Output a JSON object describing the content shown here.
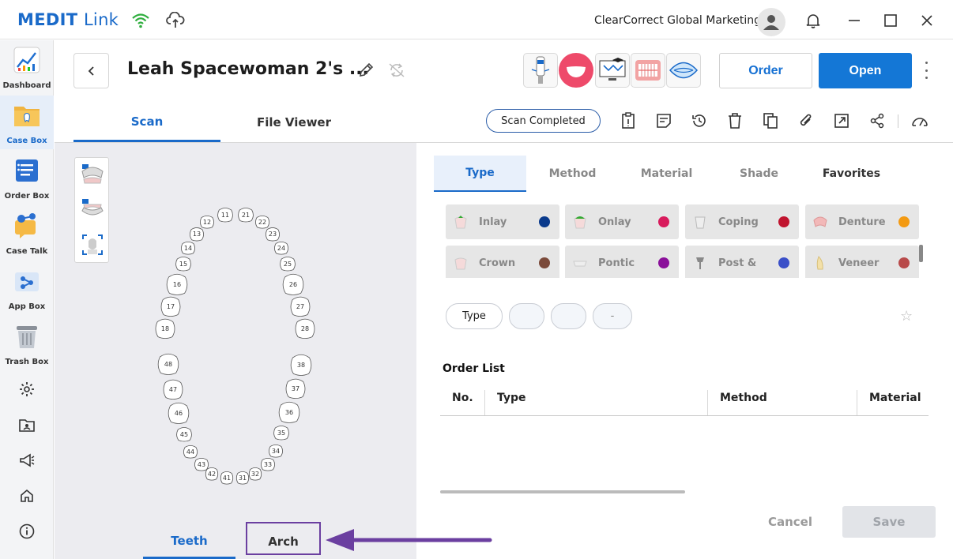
{
  "titlebar": {
    "logo_bold": "MEDIT",
    "logo_light": "Link",
    "user_name": "ClearCorrect Global Marketing"
  },
  "sidebar": {
    "items": [
      {
        "label": "Dashboard"
      },
      {
        "label": "Case Box"
      },
      {
        "label": "Order Box"
      },
      {
        "label": "Case Talk"
      },
      {
        "label": "App Box"
      },
      {
        "label": "Trash Box"
      }
    ]
  },
  "case": {
    "title": "Leah Spacewoman 2's ...",
    "order_label": "Order",
    "open_label": "Open"
  },
  "tabs": {
    "scan": "Scan",
    "file_viewer": "File Viewer",
    "status": "Scan Completed"
  },
  "teeth": {
    "upper": [
      "11",
      "12",
      "13",
      "14",
      "15",
      "16",
      "17",
      "18",
      "21",
      "22",
      "23",
      "24",
      "25",
      "26",
      "27",
      "28"
    ],
    "lower": [
      "48",
      "47",
      "46",
      "45",
      "44",
      "43",
      "42",
      "41",
      "31",
      "32",
      "33",
      "34",
      "35",
      "36",
      "37",
      "38"
    ]
  },
  "bottom_tabs": {
    "teeth": "Teeth",
    "arch": "Arch"
  },
  "right": {
    "tabs": [
      "Type",
      "Method",
      "Material",
      "Shade",
      "Favorites"
    ],
    "types": [
      {
        "name": "Inlay",
        "color": "#0a3a8c"
      },
      {
        "name": "Onlay",
        "color": "#d81b5c"
      },
      {
        "name": "Coping",
        "color": "#c0142f"
      },
      {
        "name": "Denture",
        "color": "#f39a12"
      },
      {
        "name": "Crown",
        "color": "#7b4a3a"
      },
      {
        "name": "Pontic",
        "color": "#8a0f9a"
      },
      {
        "name": "Post &",
        "color": "#3a4fc8"
      },
      {
        "name": "Veneer",
        "color": "#b84a4a"
      }
    ],
    "chips": [
      "Type",
      "",
      "",
      "-"
    ],
    "order_list_title": "Order List",
    "columns": [
      "No.",
      "Type",
      "Method",
      "Material"
    ],
    "cancel_label": "Cancel",
    "save_label": "Save"
  },
  "colors": {
    "accent": "#1a6ac9",
    "highlight": "#6b3fa0"
  }
}
